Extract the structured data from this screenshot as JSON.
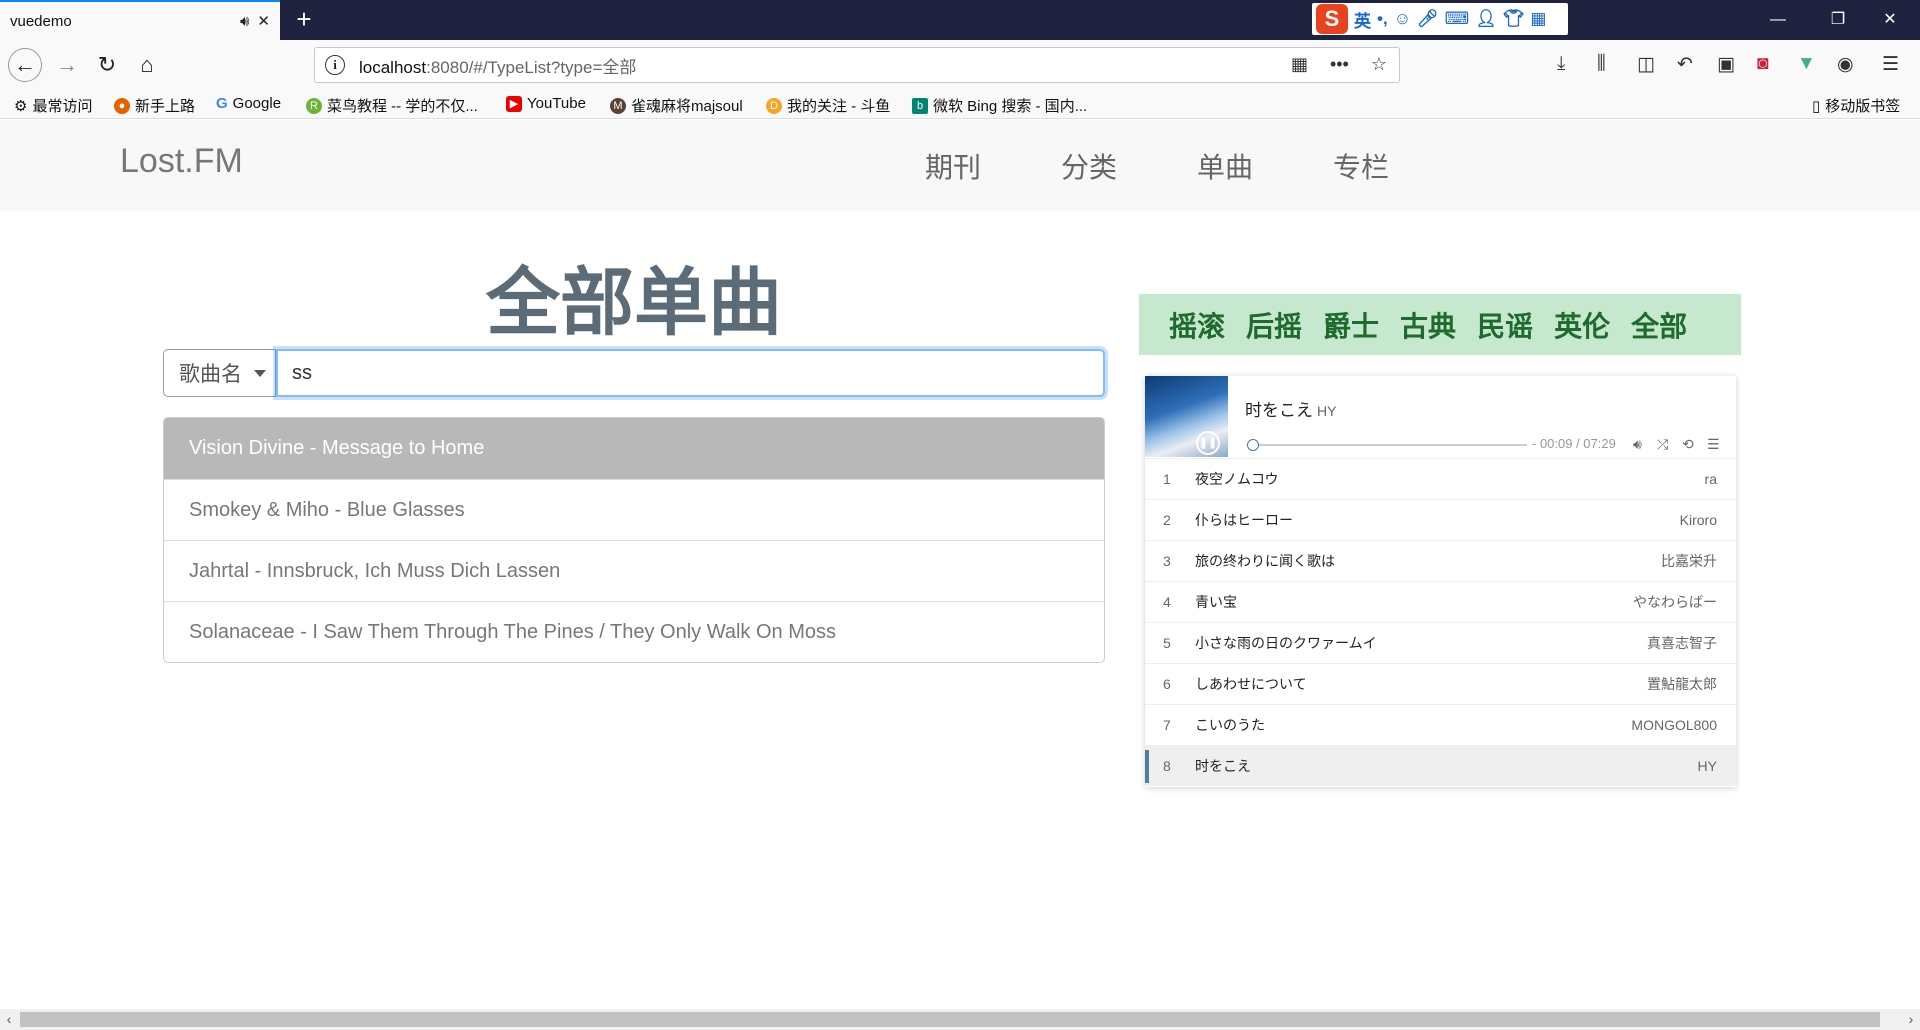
{
  "browser": {
    "tab_title": "vuedemo",
    "url_host": "localhost",
    "url_rest": ":8080/#/TypeList?type=全部",
    "ime_label": "英",
    "bookmarks": [
      {
        "label": "最常访问",
        "icon": "gear-icon"
      },
      {
        "label": "新手上路",
        "icon": "firefox-icon"
      },
      {
        "label": "Google",
        "icon": "google-icon"
      },
      {
        "label": "菜鸟教程 -- 学的不仅...",
        "icon": "runoob-icon"
      },
      {
        "label": "YouTube",
        "icon": "youtube-icon"
      },
      {
        "label": "雀魂麻将majsoul",
        "icon": "majsoul-icon"
      },
      {
        "label": "我的关注 - 斗鱼",
        "icon": "douyu-icon"
      },
      {
        "label": "微软 Bing 搜索 - 国内...",
        "icon": "bing-icon"
      }
    ],
    "mobile_bookmarks": "移动版书签",
    "colors": {
      "titlebar": "#202340",
      "active_tab_border": "#0a84ff"
    }
  },
  "site": {
    "brand": "Lost.FM",
    "nav": [
      "期刊",
      "分类",
      "单曲",
      "专栏"
    ]
  },
  "main": {
    "title": "全部单曲",
    "search": {
      "filter": "歌曲名",
      "value": "ss"
    },
    "results": [
      "Vision Divine - Message to Home",
      "Smokey & Miho - Blue Glasses",
      "Jahrtal - Innsbruck, Ich Muss Dich Lassen",
      "Solanaceae - I Saw Them Through The Pines  /  They Only Walk On Moss"
    ]
  },
  "genres": [
    "摇滚",
    "后摇",
    "爵士",
    "古典",
    "民谣",
    "英伦",
    "全部"
  ],
  "player": {
    "now_title": "时をこえ",
    "now_artist": "HY",
    "time": "- 00:09 / 07:29",
    "progress": 0.02,
    "playlist": [
      {
        "num": "1",
        "title": "夜空ノムコウ",
        "artist": "ra"
      },
      {
        "num": "2",
        "title": "仆らはヒーロー",
        "artist": "Kiroro"
      },
      {
        "num": "3",
        "title": "旅の终わりに闻く歌は",
        "artist": "比嘉栄升"
      },
      {
        "num": "4",
        "title": "青い宝",
        "artist": "やなわらばー"
      },
      {
        "num": "5",
        "title": "小さな雨の日のクワァームイ",
        "artist": "真喜志智子"
      },
      {
        "num": "6",
        "title": "しあわせについて",
        "artist": "置鮎龍太郎"
      },
      {
        "num": "7",
        "title": "こいのうた",
        "artist": "MONGOL800"
      },
      {
        "num": "8",
        "title": "时をこえ",
        "artist": "HY"
      }
    ],
    "active_index": 7
  }
}
